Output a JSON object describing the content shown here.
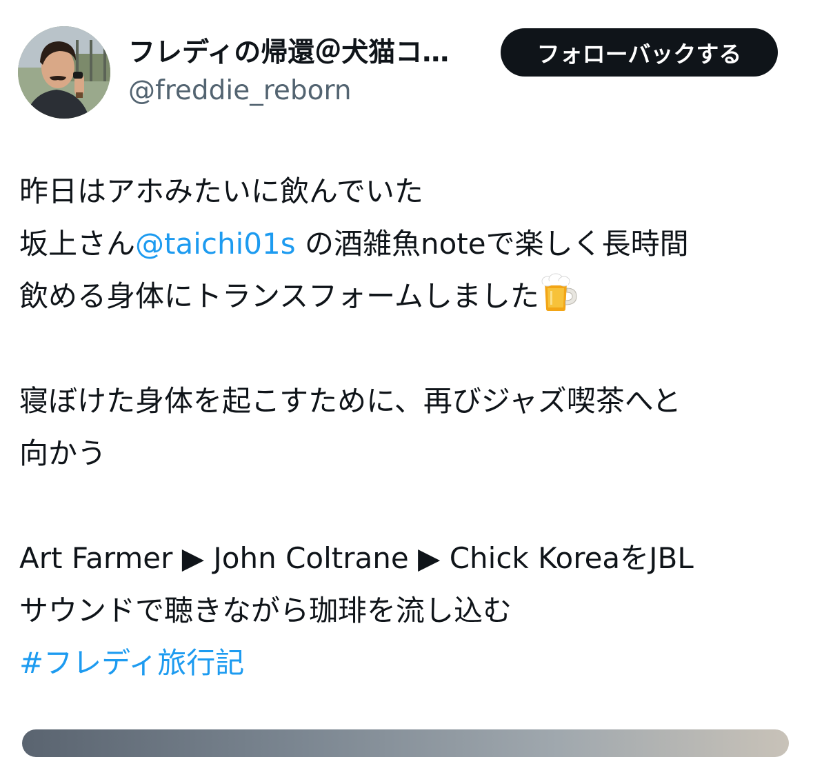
{
  "header": {
    "display_name": "フレディの帰還＠犬猫コ…",
    "handle": "@freddie_reborn",
    "follow_button_label": "フォローバックする",
    "avatar_icon": "user-avatar-icon"
  },
  "tweet": {
    "line1": "昨日はアホみたいに飲んでいた",
    "line2_prefix": "坂上さん",
    "line2_mention": "@taichi01s",
    "line2_suffix": " の酒雑魚noteで楽しく長時間",
    "line3": "飲める身体にトランスフォームしました",
    "line3_emoji": "beer-mug-icon",
    "line4": "寝ぼけた身体を起こすために、再びジャズ喫茶へと",
    "line5": "向かう",
    "line6": "Art Farmer ▶ John Coltrane ▶ Chick KoreaをJBL",
    "line7": "サウンドで聴きながら珈琲を流し込む",
    "hashtag": "#フレディ旅行記"
  },
  "colors": {
    "text": "#0f1419",
    "secondary": "#536471",
    "link": "#1d9bf0",
    "button_bg": "#0f1419",
    "button_text": "#ffffff"
  }
}
